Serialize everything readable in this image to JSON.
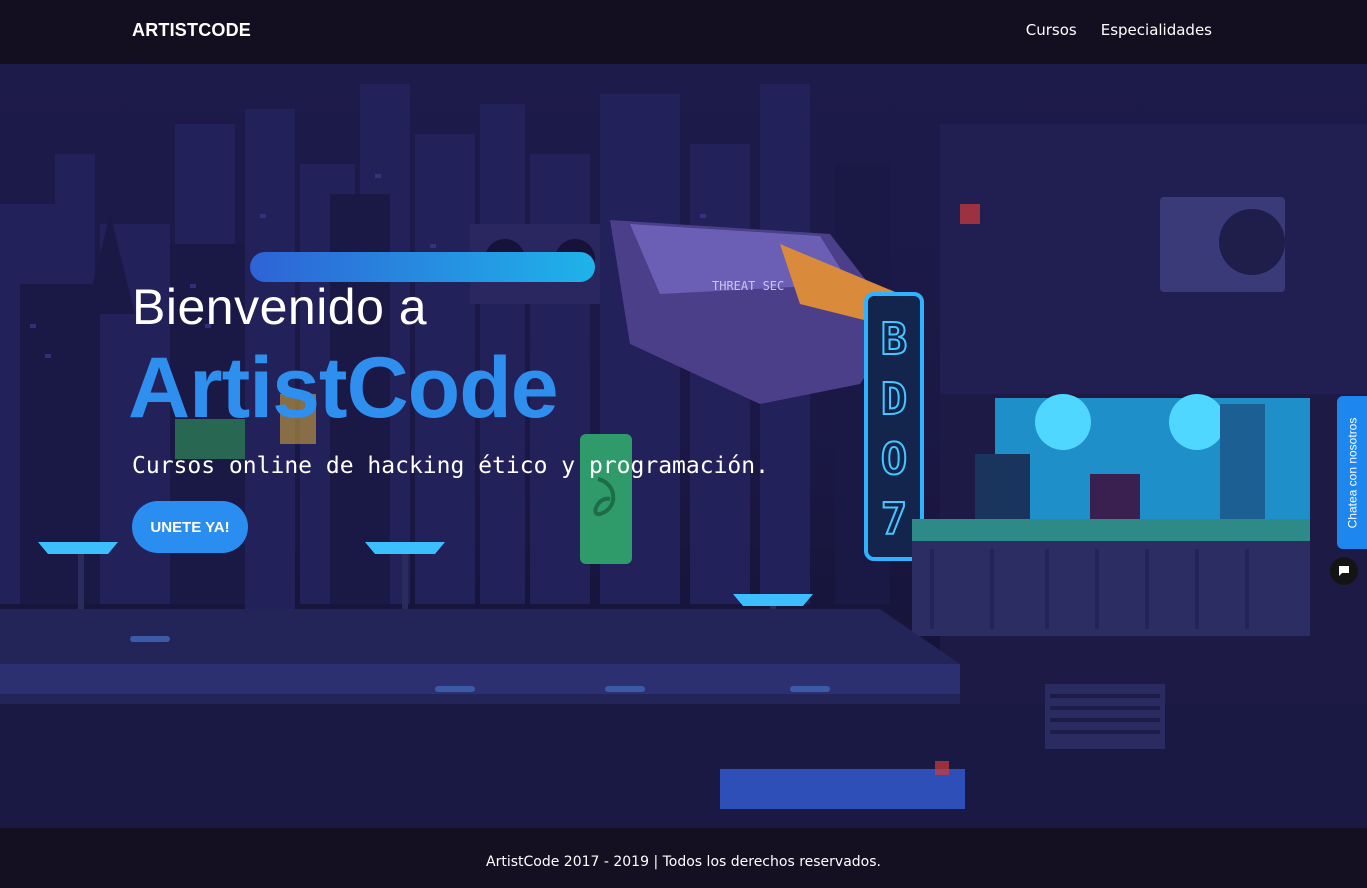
{
  "nav": {
    "brand": "ARTISTCODE",
    "links": [
      "Cursos",
      "Especialidades"
    ]
  },
  "hero": {
    "title": "Bienvenido a",
    "brand": "ArtistCode",
    "subtitle": "Cursos online de hacking ético y programación.",
    "cta": "UNETE YA!",
    "sign_text": "THREAT SEC",
    "neon_sign": "BDO7"
  },
  "chat": {
    "label": "Chatea con nosotros"
  },
  "footer": {
    "text": "ArtistCode 2017 - 2019 | Todos los derechos reservados."
  },
  "colors": {
    "accent": "#2f8fee",
    "button": "#2a8ef0",
    "background": "#1b1846",
    "nav": "#130f20"
  }
}
